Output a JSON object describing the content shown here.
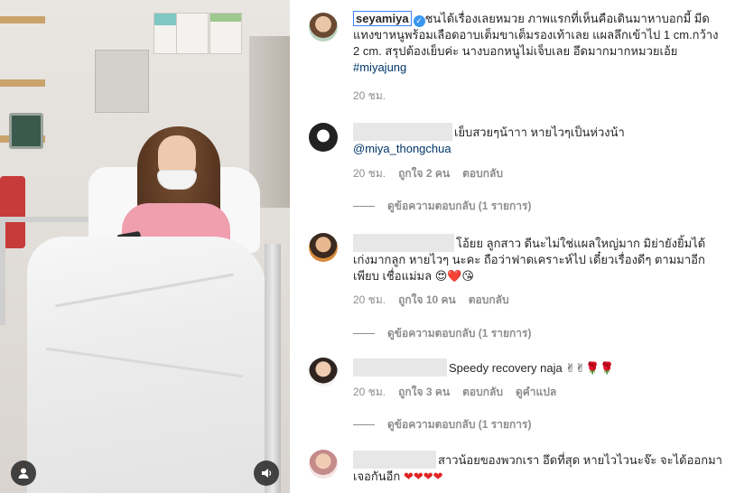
{
  "post": {
    "username": "seyamiya",
    "caption": "ชนได้เรื่องเลยหมวย ภาพแรกที่เห็นคือเดินมาหาบอกมี้ มีดแทงขาหนูพร้อมเลือดอาบเต็มขาเต็มรองเท้าเลย แผลลึกเข้าไป 1 cm.กว้าง 2 cm. สรุปต้องเย็บค่ะ นางบอกหนูไม่เจ็บเลย อึดมากมากหมวยเอ้ย ",
    "hashtag": "#miyajung",
    "time": "20 ชม."
  },
  "comments": [
    {
      "text": "เย็บสวยๆน้าาา หายไวๆเป็นห่วงน้า",
      "mention": "@miya_thongchua",
      "time": "20 ชม.",
      "likes": "ถูกใจ 2 คน",
      "reply": "ตอบกลับ",
      "view_replies": "ดูข้อความตอบกลับ (1 รายการ)"
    },
    {
      "text": "โอ้ยย ลูกสาว ดีนะไม่ใช่แผลใหญ่มาก มิย่ายังยิ้มได้ เก่งมากลูก หายไวๆ นะคะ ถือว่าฟาดเคราะห์ไป เดี๋ยวเรื่องดีๆ ตามมาอีกเพียบ เชื่อแม่มล",
      "emoji": "😍❤️😘",
      "time": "20 ชม.",
      "likes": "ถูกใจ 10 คน",
      "reply": "ตอบกลับ",
      "view_replies": "ดูข้อความตอบกลับ (1 รายการ)"
    },
    {
      "text": "Speedy recovery naja",
      "emoji": "✌✌🌹🌹",
      "time": "20 ชม.",
      "likes": "ถูกใจ 3 คน",
      "reply": "ตอบกลับ",
      "translate": "ดูคำแปล",
      "view_replies": "ดูข้อความตอบกลับ (1 รายการ)"
    },
    {
      "text": "สาวน้อยของพวกเรา อึดที่สุด หายไวไวนะจ๊ะ จะได้ออกมาเจอกันอีก",
      "emoji": "❤❤❤❤"
    }
  ],
  "icons": {
    "verified": "verified-badge-icon",
    "tagged_users": "user-icon",
    "sound": "speaker-icon"
  },
  "colors": {
    "link": "#00376b",
    "muted": "#8e8e8e",
    "verified": "#3897f0"
  }
}
